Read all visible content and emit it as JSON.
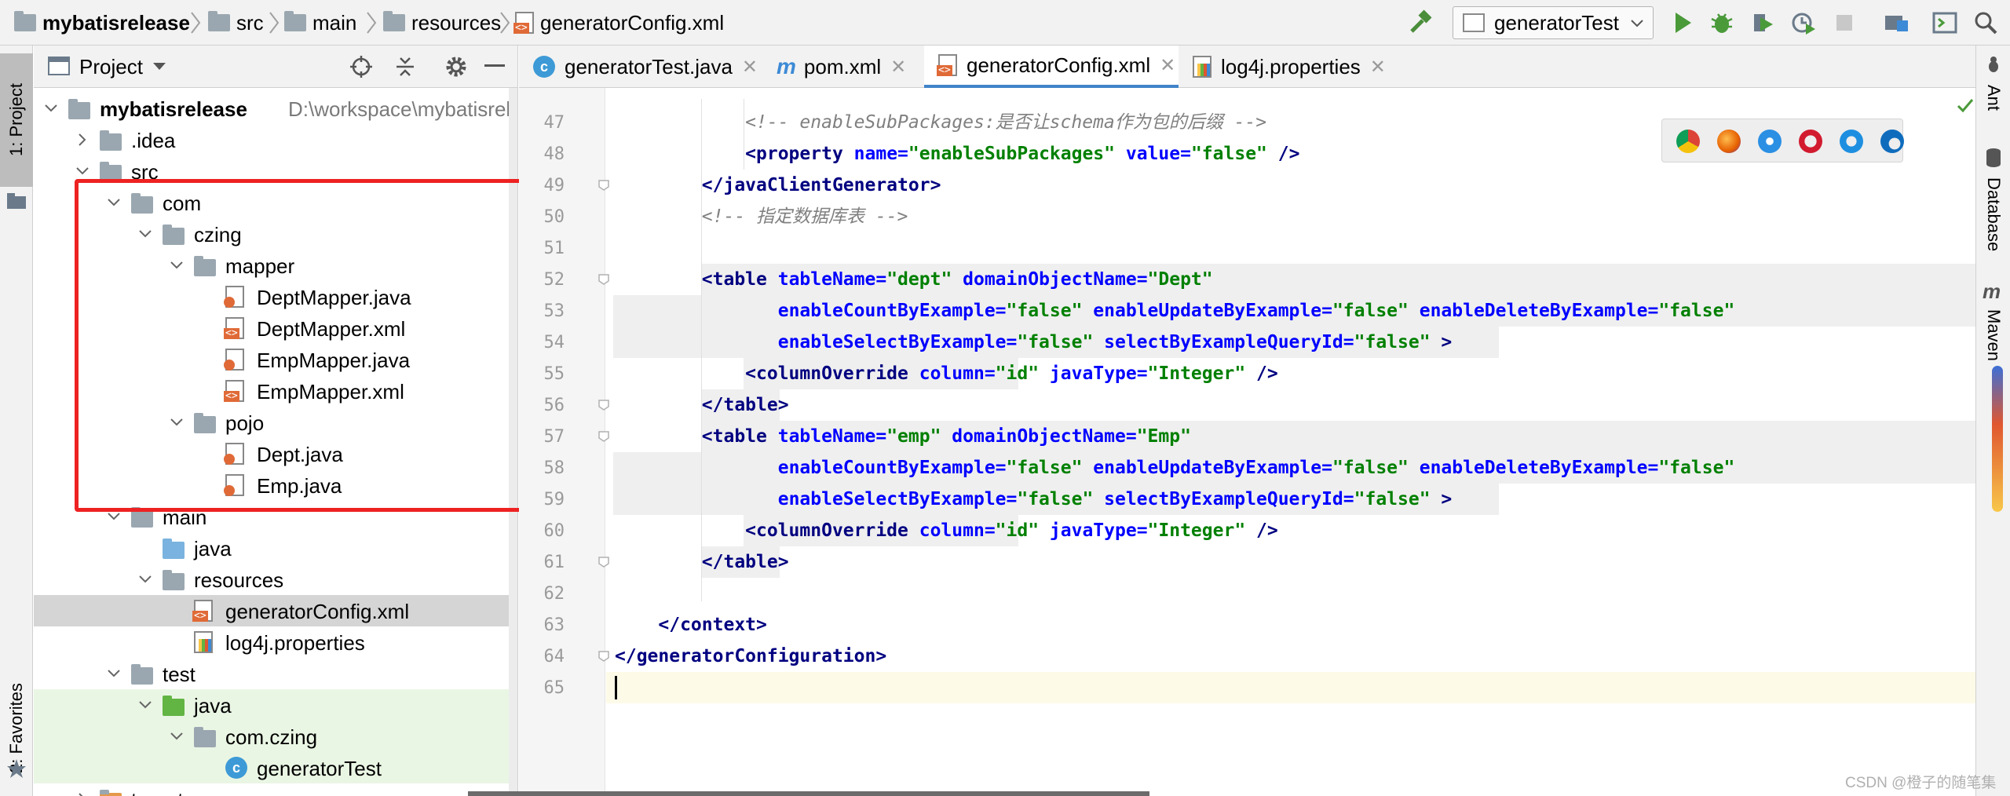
{
  "navbar": {
    "breadcrumbs": [
      {
        "label": "mybatisrelease",
        "icon": "module-folder-icon"
      },
      {
        "label": "src",
        "icon": "folder-icon"
      },
      {
        "label": "main",
        "icon": "folder-icon"
      },
      {
        "label": "resources",
        "icon": "resources-folder-icon"
      },
      {
        "label": "generatorConfig.xml",
        "icon": "xml-file-icon"
      }
    ],
    "run_config": "generatorTest"
  },
  "left_strip": {
    "project_tab": "1: Project",
    "favorites_tab": "2: Favorites"
  },
  "right_strip": {
    "ant_tab": "Ant",
    "database_tab": "Database",
    "maven_tab": "Maven"
  },
  "project_panel": {
    "title": "Project",
    "tree": [
      {
        "label": "mybatisrelease",
        "path": "D:\\workspace\\mybatisreleas",
        "icon": "module-folder-icon",
        "depth": 0,
        "expanded": true
      },
      {
        "label": ".idea",
        "icon": "folder-icon",
        "depth": 1,
        "expanded": false
      },
      {
        "label": "src",
        "icon": "folder-icon",
        "depth": 1,
        "expanded": true
      },
      {
        "label": "com",
        "icon": "folder-icon",
        "depth": 2,
        "expanded": true
      },
      {
        "label": "czing",
        "icon": "folder-icon",
        "depth": 3,
        "expanded": true
      },
      {
        "label": "mapper",
        "icon": "folder-icon",
        "depth": 4,
        "expanded": true
      },
      {
        "label": "DeptMapper.java",
        "icon": "java-file-icon",
        "depth": 5
      },
      {
        "label": "DeptMapper.xml",
        "icon": "xml-file-icon",
        "depth": 5
      },
      {
        "label": "EmpMapper.java",
        "icon": "java-file-icon",
        "depth": 5
      },
      {
        "label": "EmpMapper.xml",
        "icon": "xml-file-icon",
        "depth": 5
      },
      {
        "label": "pojo",
        "icon": "folder-icon",
        "depth": 4,
        "expanded": true
      },
      {
        "label": "Dept.java",
        "icon": "java-file-icon",
        "depth": 5
      },
      {
        "label": "Emp.java",
        "icon": "java-file-icon",
        "depth": 5
      },
      {
        "label": "main",
        "icon": "folder-icon",
        "depth": 2,
        "expanded": true
      },
      {
        "label": "java",
        "icon": "source-folder-icon",
        "depth": 3
      },
      {
        "label": "resources",
        "icon": "resources-folder-icon",
        "depth": 3,
        "expanded": true
      },
      {
        "label": "generatorConfig.xml",
        "icon": "xml-file-icon",
        "depth": 4,
        "selected": true
      },
      {
        "label": "log4j.properties",
        "icon": "properties-file-icon",
        "depth": 4
      },
      {
        "label": "test",
        "icon": "folder-icon",
        "depth": 2,
        "expanded": true
      },
      {
        "label": "java",
        "icon": "test-folder-icon",
        "depth": 3,
        "expanded": true,
        "test": true
      },
      {
        "label": "com.czing",
        "icon": "package-icon",
        "depth": 4,
        "expanded": true,
        "test": true
      },
      {
        "label": "generatorTest",
        "icon": "class-icon",
        "depth": 5,
        "test": true
      },
      {
        "label": "target",
        "icon": "excluded-folder-icon",
        "depth": 1,
        "expanded": false
      }
    ]
  },
  "editor": {
    "tabs": [
      {
        "label": "generatorTest.java",
        "icon": "class-icon",
        "active": false
      },
      {
        "label": "pom.xml",
        "icon": "maven-icon",
        "active": false
      },
      {
        "label": "generatorConfig.xml",
        "icon": "xml-file-icon",
        "active": true
      },
      {
        "label": "log4j.properties",
        "icon": "properties-file-icon",
        "active": false
      }
    ],
    "lines": [
      {
        "n": "47",
        "tokens": [
          [
            "c",
            "            <!-- enableSubPackages:是否让schema作为包的后缀 -->"
          ]
        ]
      },
      {
        "n": "48",
        "tokens": [
          [
            "p",
            "            "
          ],
          [
            "t",
            "<property "
          ],
          [
            "a",
            "name="
          ],
          [
            "v",
            "\"enableSubPackages\" "
          ],
          [
            "a",
            "value="
          ],
          [
            "v",
            "\"false\" "
          ],
          [
            "t",
            "/>"
          ]
        ]
      },
      {
        "n": "49",
        "tokens": [
          [
            "p",
            "        "
          ],
          [
            "t",
            "</javaClientGenerator>"
          ]
        ]
      },
      {
        "n": "50",
        "tokens": [
          [
            "c",
            "        <!-- 指定数据库表 -->"
          ]
        ]
      },
      {
        "n": "51",
        "tokens": []
      },
      {
        "n": "52",
        "tokens": [
          [
            "p",
            "        "
          ],
          [
            "t",
            "<table "
          ],
          [
            "a",
            "tableName="
          ],
          [
            "v",
            "\"dept\" "
          ],
          [
            "a",
            "domainObjectName="
          ],
          [
            "v",
            "\"Dept\""
          ]
        ]
      },
      {
        "n": "53",
        "tokens": [
          [
            "p",
            "               "
          ],
          [
            "a",
            "enableCountByExample="
          ],
          [
            "v",
            "\"false\" "
          ],
          [
            "a",
            "enableUpdateByExample="
          ],
          [
            "v",
            "\"false\" "
          ],
          [
            "a",
            "enableDeleteByExample="
          ],
          [
            "v",
            "\"false\""
          ]
        ]
      },
      {
        "n": "54",
        "tokens": [
          [
            "p",
            "               "
          ],
          [
            "a",
            "enableSelectByExample="
          ],
          [
            "v",
            "\"false\" "
          ],
          [
            "a",
            "selectByExampleQueryId="
          ],
          [
            "v",
            "\"false\" "
          ],
          [
            "t",
            ">"
          ]
        ]
      },
      {
        "n": "55",
        "tokens": [
          [
            "p",
            "            "
          ],
          [
            "t",
            "<columnOverride "
          ],
          [
            "a",
            "column="
          ],
          [
            "v",
            "\"id\" "
          ],
          [
            "a",
            "javaType="
          ],
          [
            "v",
            "\"Integer\" "
          ],
          [
            "t",
            "/>"
          ]
        ]
      },
      {
        "n": "56",
        "tokens": [
          [
            "p",
            "        "
          ],
          [
            "t",
            "</table>"
          ]
        ]
      },
      {
        "n": "57",
        "tokens": [
          [
            "p",
            "        "
          ],
          [
            "t",
            "<table "
          ],
          [
            "a",
            "tableName="
          ],
          [
            "v",
            "\"emp\" "
          ],
          [
            "a",
            "domainObjectName="
          ],
          [
            "v",
            "\"Emp\""
          ]
        ]
      },
      {
        "n": "58",
        "tokens": [
          [
            "p",
            "               "
          ],
          [
            "a",
            "enableCountByExample="
          ],
          [
            "v",
            "\"false\" "
          ],
          [
            "a",
            "enableUpdateByExample="
          ],
          [
            "v",
            "\"false\" "
          ],
          [
            "a",
            "enableDeleteByExample="
          ],
          [
            "v",
            "\"false\""
          ]
        ]
      },
      {
        "n": "59",
        "tokens": [
          [
            "p",
            "               "
          ],
          [
            "a",
            "enableSelectByExample="
          ],
          [
            "v",
            "\"false\" "
          ],
          [
            "a",
            "selectByExampleQueryId="
          ],
          [
            "v",
            "\"false\" "
          ],
          [
            "t",
            ">"
          ]
        ]
      },
      {
        "n": "60",
        "tokens": [
          [
            "p",
            "            "
          ],
          [
            "t",
            "<columnOverride "
          ],
          [
            "a",
            "column="
          ],
          [
            "v",
            "\"id\" "
          ],
          [
            "a",
            "javaType="
          ],
          [
            "v",
            "\"Integer\" "
          ],
          [
            "t",
            "/>"
          ]
        ]
      },
      {
        "n": "61",
        "tokens": [
          [
            "p",
            "        "
          ],
          [
            "t",
            "</table>"
          ]
        ]
      },
      {
        "n": "62",
        "tokens": []
      },
      {
        "n": "63",
        "tokens": [
          [
            "p",
            "    "
          ],
          [
            "t",
            "</context>"
          ]
        ]
      },
      {
        "n": "64",
        "tokens": [
          [
            "t",
            "</generatorConfiguration>"
          ]
        ]
      },
      {
        "n": "65",
        "tokens": []
      }
    ],
    "browser_icons": [
      "chrome-icon",
      "firefox-icon",
      "safari-icon",
      "opera-icon",
      "ie-icon",
      "edge-icon"
    ]
  },
  "watermark": "CSDN @橙子的随笔集",
  "colors": {
    "highlight_box": "#ee2222",
    "tag": "#000080",
    "attr": "#0000ff",
    "value": "#008000",
    "comment": "#808080",
    "selected_row": "#d5d5d5",
    "test_row": "#eaf6e4",
    "active_tab_underline": "#4083c9"
  }
}
